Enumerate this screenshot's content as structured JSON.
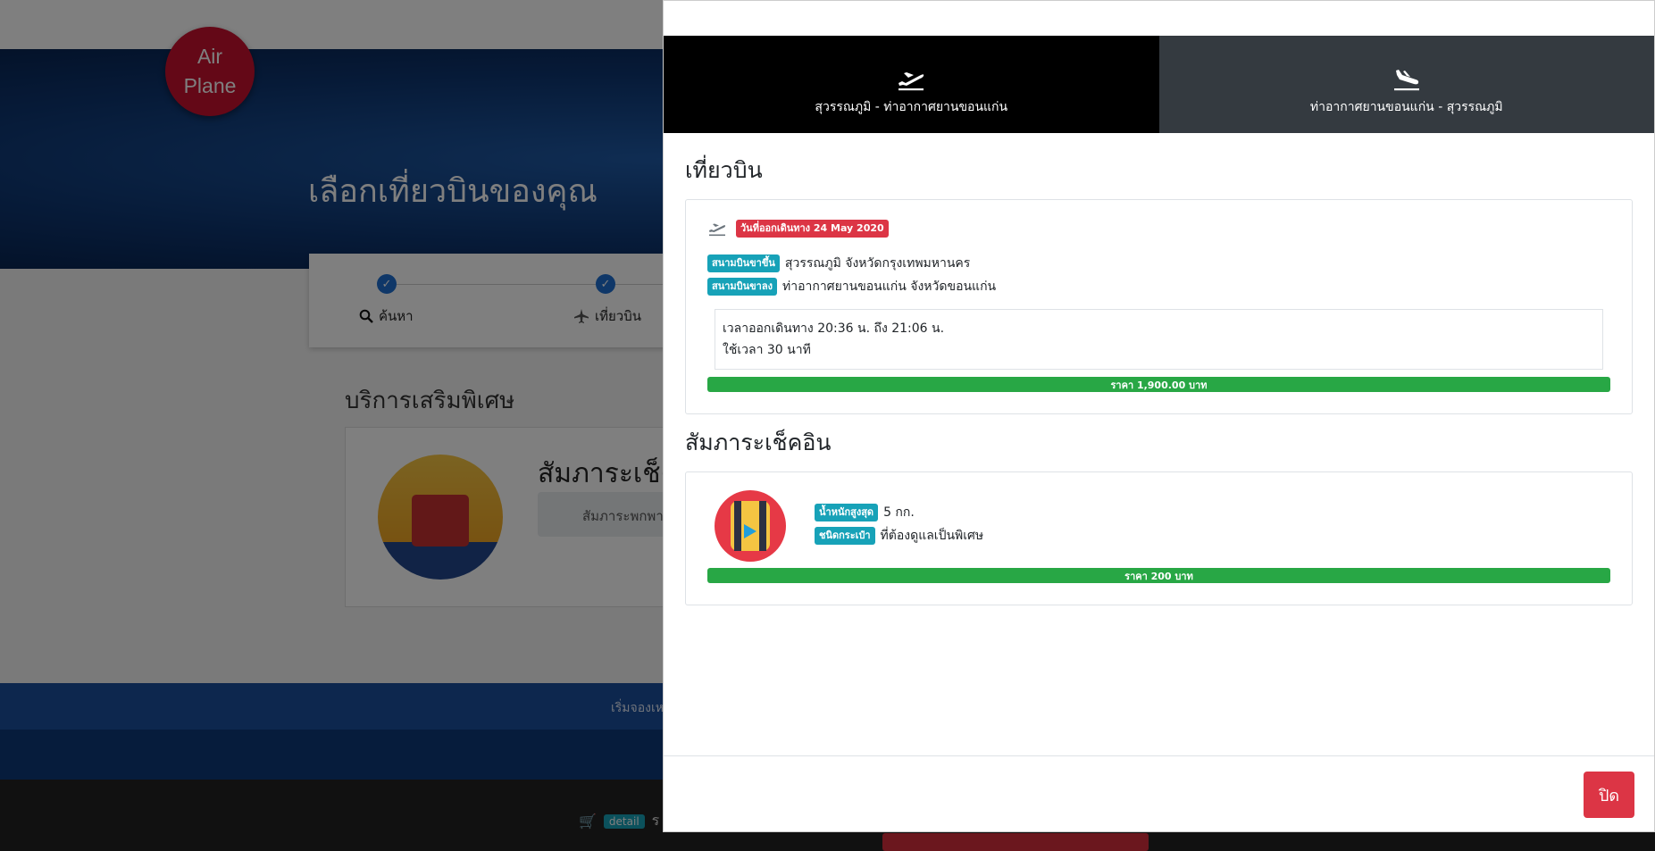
{
  "background": {
    "logo": {
      "line1": "Air",
      "line2": "Plane"
    },
    "hero_title": "เลือกเที่ยวบินของคุณ",
    "steps": [
      {
        "label": "ค้นหา"
      },
      {
        "label": "เที่ยวบิน"
      }
    ],
    "section_title": "บริการเสริมพิเศษ",
    "card_title": "สัมภาระเช็คอ",
    "card_note": "สัมภาระพกพา",
    "footer_text": "เริ่มจองเห",
    "cart_badge": "detail",
    "cart_text": "ร"
  },
  "modal": {
    "tabs": [
      {
        "label": "สุวรรณภูมิ - ท่าอากาศยานขอนแก่น",
        "icon": "takeoff-icon",
        "active": true
      },
      {
        "label": "ท่าอากาศยานขอนแก่น - สุวรรณภูมิ",
        "icon": "landing-icon",
        "active": false
      }
    ],
    "flight_section": {
      "title": "เที่ยวบิน",
      "departure_badge": "วันที่ออกเดินทาง 24 May 2020",
      "origin_badge": "สนามบินขาขึ้น",
      "origin_value": "สุวรรณภูมิ จังหวัดกรุงเทพมหานคร",
      "destination_badge": "สนามบินขาลง",
      "destination_value": "ท่าอากาศยานขอนแก่น จังหวัดขอนแก่น",
      "time_line": "เวลาออกเดินทาง 20:36 น. ถึง 21:06 น.",
      "duration_line": "ใช้เวลา 30 นาที",
      "price": "ราคา 1,900.00 บาท"
    },
    "baggage_section": {
      "title": "สัมภาระเช็คอิน",
      "weight_badge": "น้ำหนักสูงสุด",
      "weight_value": "5 กก.",
      "type_badge": "ชนิดกระเป๋า",
      "type_value": "ที่ต้องดูแลเป็นพิเศษ",
      "price": "ราคา 200 บาท"
    },
    "close_label": "ปิด"
  },
  "colors": {
    "tab_active": "#000000",
    "tab_inactive": "#343a40",
    "badge_red": "#dc3545",
    "badge_teal": "#17a2b8",
    "price_green": "#28a745",
    "close_red": "#dc3545"
  }
}
